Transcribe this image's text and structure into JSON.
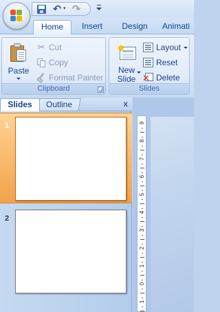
{
  "quick_access": {
    "save_icon": "save-icon",
    "undo_icon": "undo-icon",
    "undo_glyph": "↶",
    "redo_icon": "redo-icon",
    "redo_glyph": "↷"
  },
  "tabs": [
    {
      "label": "Home",
      "active": true
    },
    {
      "label": "Insert",
      "active": false
    },
    {
      "label": "Design",
      "active": false
    },
    {
      "label": "Animati",
      "active": false
    }
  ],
  "ribbon": {
    "clipboard": {
      "label": "Clipboard",
      "paste": "Paste",
      "cut": "Cut",
      "copy": "Copy",
      "format_painter": "Format Painter"
    },
    "slides": {
      "label": "Slides",
      "new_slide_line1": "New",
      "new_slide_line2": "Slide",
      "layout": "Layout",
      "reset": "Reset",
      "delete": "Delete"
    }
  },
  "pane": {
    "tab_slides": "Slides",
    "tab_outline": "Outline",
    "close": "x",
    "thumbnails": [
      {
        "number": "1",
        "selected": true
      },
      {
        "number": "2",
        "selected": false
      }
    ]
  },
  "ruler": {
    "labels": [
      "9",
      "8",
      "7",
      "6",
      "5",
      "4",
      "3",
      "2",
      "1",
      "0",
      "1"
    ]
  },
  "colors": {
    "accent_selected": "#f2a24a",
    "ribbon_text": "#15428b",
    "delete_red": "#d4251c"
  }
}
